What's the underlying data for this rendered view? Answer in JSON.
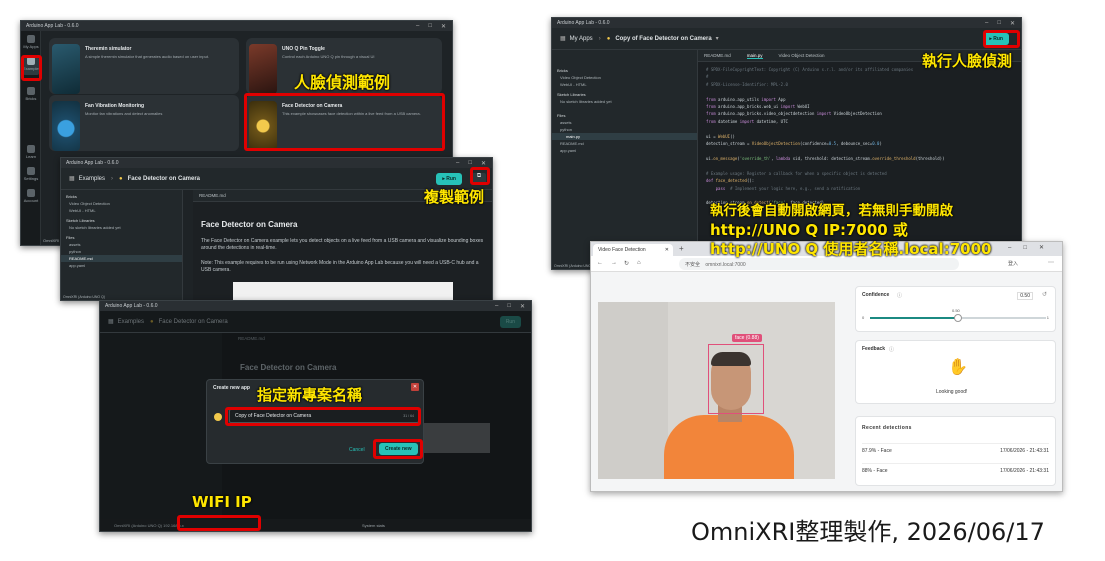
{
  "win1": {
    "title": "Arduino App Lab - 0.6.0",
    "rail": [
      "My Apps",
      "Examples",
      "Bricks",
      "Learn",
      "Settings",
      "Account"
    ],
    "cards": [
      {
        "title": "Theremin simulator",
        "desc": "A simple theremin simulator that generates audio based on user input."
      },
      {
        "title": "UNO Q Pin Toggle",
        "desc": "Control each Arduino UNO Q pin through a visual UI"
      },
      {
        "title": "Fan Vibration Monitoring",
        "desc": "Monitor fan vibrations and detect anomalies"
      },
      {
        "title": "Face Detector on Camera",
        "desc": "This example showcases face detection within a live feed from a USB camera."
      }
    ],
    "status": "OmniXRI (Arduino UNO Q)"
  },
  "win2": {
    "title": "Arduino App Lab - 0.6.0",
    "breadcrumb_root": "Examples",
    "app_name": "Face Detector on Camera",
    "run_label": "Run",
    "sidebar": {
      "bricks_label": "Bricks",
      "bricks": [
        "Video Object Detection",
        "WebUI - HTML"
      ],
      "sketch_label": "Sketch Libraries",
      "sketch_note": "No sketch libraries added yet",
      "files_label": "Files",
      "files": [
        "assets",
        "python",
        "README.md",
        "app.yaml"
      ]
    },
    "tab": "README.md",
    "doc_title": "Face Detector on Camera",
    "doc_p1": "The Face Detector on Camera example lets you detect objects on a live feed from a USB camera and visualize bounding boxes around the detections in real-time.",
    "doc_p2": "Note: This example requires to be run using Network Mode in the Arduino App Lab because you will need a USB-C hub and a USB camera.",
    "status": "OmniXRI (Arduino UNO Q)"
  },
  "win3": {
    "title": "Arduino App Lab - 0.6.0",
    "breadcrumb_root": "Examples",
    "app_name": "Face Detector on Camera",
    "run_label": "Run",
    "tab": "README.md",
    "doc_title": "Face Detector on Camera",
    "dialog": {
      "title": "Create new app",
      "input_value": "Copy of Face Detector on Camera",
      "counter": "31 / 64",
      "cancel": "Cancel",
      "create": "Create new"
    },
    "status_ip": "OmniXRI (Arduino UNO Q) 192.168.x.x",
    "status_right": "System stats"
  },
  "win4": {
    "title": "Arduino App Lab - 0.6.0",
    "breadcrumb_root": "My Apps",
    "app_name": "Copy of Face Detector on Camera",
    "run_label": "Run",
    "tabs": [
      "README.md",
      "main.py",
      "Video Object Detection"
    ],
    "sidebar": {
      "bricks_label": "Bricks",
      "bricks": [
        "Video Object Detection",
        "WebUI - HTML"
      ],
      "sketch_label": "Sketch Libraries",
      "sketch_note": "No sketch libraries added yet",
      "files_label": "Files",
      "files": [
        "assets",
        "python",
        "main.py",
        "README.md",
        "app.yaml"
      ]
    },
    "status": "OmniXRI (Arduino UNO Q)"
  },
  "browser": {
    "tab_title": "Video Face Detection",
    "insecure": "不安全",
    "url": "omnixri.local:7000",
    "login": "登入",
    "face_label": "face (0.88)",
    "confidence_title": "Confidence",
    "confidence_value": "0.50",
    "conf_min": "0",
    "conf_mark": "0.50",
    "conf_max": "1",
    "feedback_title": "Feedback",
    "feedback_text": "Looking good!",
    "recent_title": "Recent detections",
    "recent": [
      {
        "label": "87.9% - Face",
        "time": "17/06/2026 - 21:43:31"
      },
      {
        "label": "88% - Face",
        "time": "17/06/2026 - 21:43:31"
      }
    ],
    "confidence_level": 0.5
  },
  "annotations": {
    "face_example": "人臉偵測範例",
    "copy_example": "複製範例",
    "name_project": "指定新專案名稱",
    "wifi_ip": "WIFI IP",
    "run_face": "執行人臉偵測",
    "auto_line1": "執行後會自動開啟網頁，若無則手動開啟",
    "auto_line2": "http://UNO Q IP:7000 或",
    "auto_line3": "http://UNO Q 使用者名稱.local:7000"
  },
  "credit": "OmniXRI整理製作, 2026/06/17",
  "colors": {
    "teal": "#27c2b8",
    "annotation": "#ffe600",
    "highlight": "#e00000"
  }
}
